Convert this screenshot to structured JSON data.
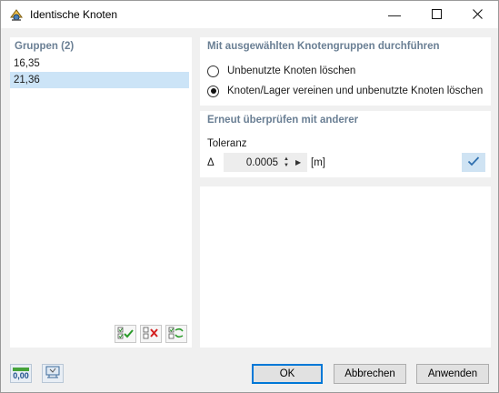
{
  "window": {
    "title": "Identische Knoten",
    "minimize_symbol": "—",
    "maximize_symbol": "☐",
    "close_symbol": "✕",
    "app_icon": "node-tool-icon"
  },
  "groups": {
    "header": "Gruppen (2)",
    "items": [
      {
        "label": "16,35",
        "selected": false
      },
      {
        "label": "21,36",
        "selected": true
      }
    ],
    "tools": [
      "select-all-icon",
      "deselect-all-icon",
      "toggle-selection-icon"
    ]
  },
  "action": {
    "title": "Mit ausgewählten Knotengruppen durchführen",
    "options": [
      {
        "label": "Unbenutzte Knoten löschen",
        "checked": false
      },
      {
        "label": "Knoten/Lager vereinen und unbenutzte Knoten löschen",
        "checked": true
      }
    ]
  },
  "recheck": {
    "title": "Erneut überprüfen mit anderer",
    "tolerance_label": "Toleranz",
    "delta_symbol": "Δ",
    "tolerance_value": "0.0005",
    "unit": "[m]",
    "apply_icon": "checkmark-icon"
  },
  "footer": {
    "icons": [
      "decimal-places-icon",
      "view-settings-icon"
    ],
    "decimal_icon_text": "0,00",
    "ok_label": "OK",
    "cancel_label": "Abbrechen",
    "apply_label": "Anwenden"
  },
  "colors": {
    "section_title": "#6a7f94",
    "selection": "#cce4f7",
    "accent": "#0078d7"
  }
}
